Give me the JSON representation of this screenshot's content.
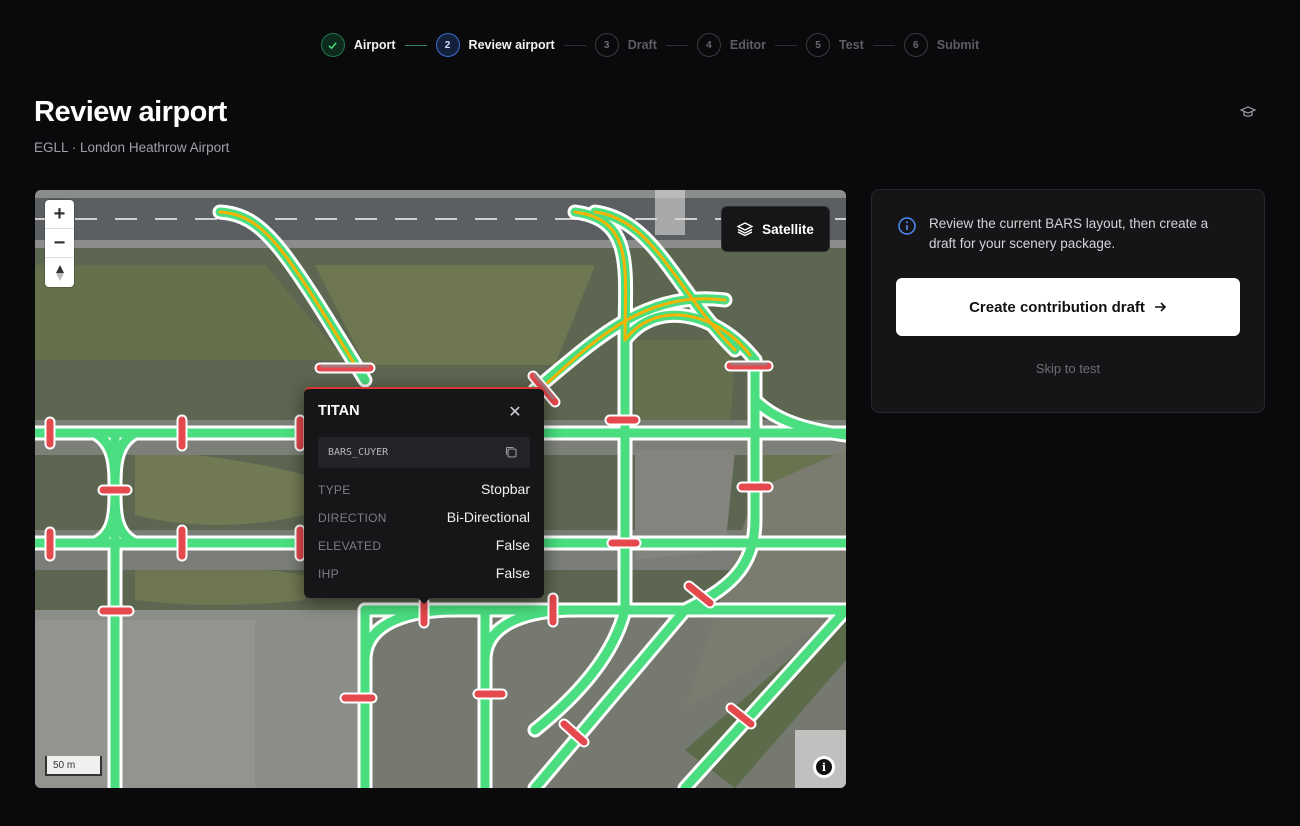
{
  "stepper": {
    "steps": [
      {
        "number": "1",
        "label": "Airport",
        "state": "done"
      },
      {
        "number": "2",
        "label": "Review airport",
        "state": "current"
      },
      {
        "number": "3",
        "label": "Draft",
        "state": "upcoming"
      },
      {
        "number": "4",
        "label": "Editor",
        "state": "upcoming"
      },
      {
        "number": "5",
        "label": "Test",
        "state": "upcoming"
      },
      {
        "number": "6",
        "label": "Submit",
        "state": "upcoming"
      }
    ]
  },
  "header": {
    "title": "Review airport",
    "subtitle": "EGLL · London Heathrow Airport",
    "help_icon": "graduation-cap-icon"
  },
  "map": {
    "zoom_in": "+",
    "zoom_out": "−",
    "compass": "▲",
    "layer_button": "Satellite",
    "scale": "50 m",
    "colors": {
      "taxiway": "#4ade80",
      "lead_on": "#f5b400",
      "stopbar": "#e5484d"
    }
  },
  "popup": {
    "title": "TITAN",
    "object_id": "BARS_CUYER",
    "rows": [
      {
        "key": "TYPE",
        "value": "Stopbar"
      },
      {
        "key": "DIRECTION",
        "value": "Bi-Directional"
      },
      {
        "key": "ELEVATED",
        "value": "False"
      },
      {
        "key": "IHP",
        "value": "False"
      }
    ]
  },
  "panel": {
    "message": "Review the current BARS layout, then create a draft for your scenery package.",
    "primary_button": "Create contribution draft",
    "skip_link": "Skip to test"
  }
}
